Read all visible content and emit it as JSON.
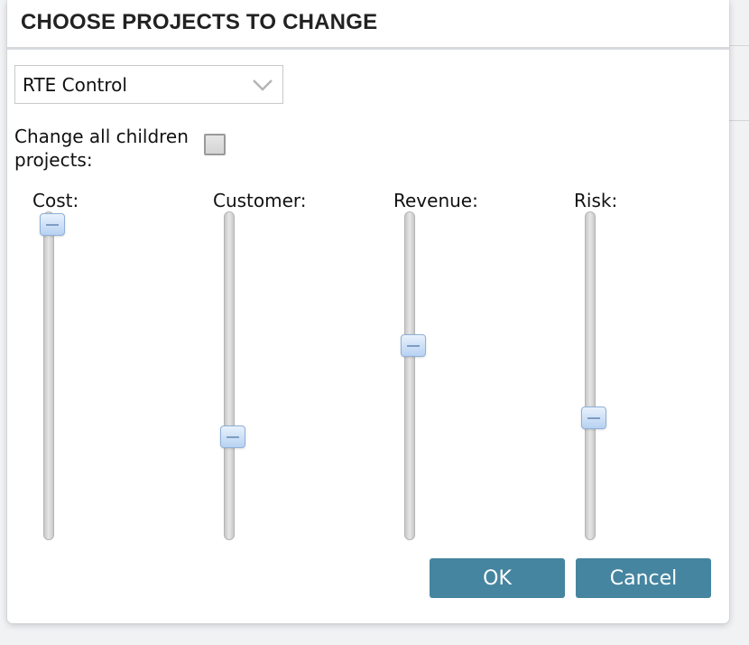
{
  "dialog": {
    "title": "CHOOSE PROJECTS TO CHANGE",
    "project_select": {
      "value": "RTE Control",
      "icon": "chevron-down-icon"
    },
    "children_checkbox": {
      "label": "Change all children projects:",
      "checked": false
    },
    "sliders": [
      {
        "label": "Cost:",
        "value": 1.0
      },
      {
        "label": "Customer:",
        "value": 0.3
      },
      {
        "label": "Revenue:",
        "value": 0.6
      },
      {
        "label": "Risk:",
        "value": 0.36
      }
    ],
    "buttons": {
      "ok": "OK",
      "cancel": "Cancel"
    },
    "colors": {
      "button": "#4585a0",
      "thumb": "#b7d2f2",
      "header_rule": "#d7d9dd"
    }
  }
}
